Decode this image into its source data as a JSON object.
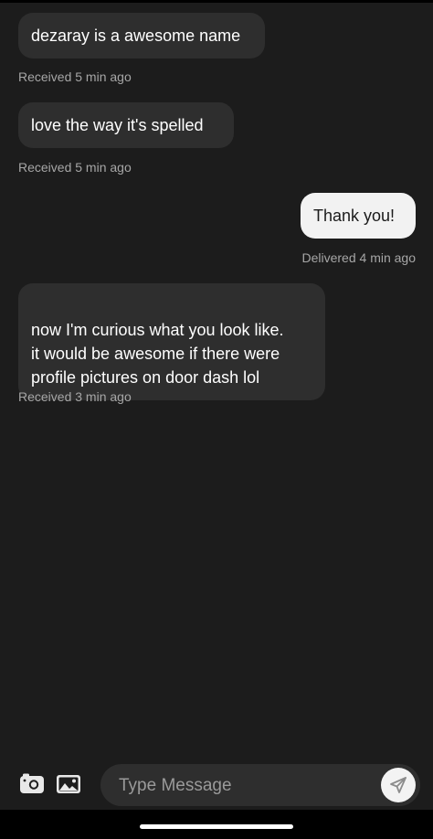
{
  "messages": [
    {
      "text": "dezaray is a awesome name",
      "status": "Received 5 min ago"
    },
    {
      "text": "love the way it's spelled",
      "status": "Received 5 min ago"
    },
    {
      "text": "Thank you!",
      "status": "Delivered 4 min ago"
    },
    {
      "text": "now I'm curious what you look like.\nit would be awesome if there were\nprofile pictures on door dash lol",
      "status": "Received 3 min ago"
    }
  ],
  "composer": {
    "placeholder": "Type Message",
    "camera_icon": "camera-icon",
    "gallery_icon": "image-icon",
    "send_icon": "send-icon"
  },
  "colors": {
    "background": "#1c1c1c",
    "received_bubble": "#2e2e2e",
    "sent_bubble": "#f2f2f2",
    "meta_text": "#a6a6a6"
  }
}
